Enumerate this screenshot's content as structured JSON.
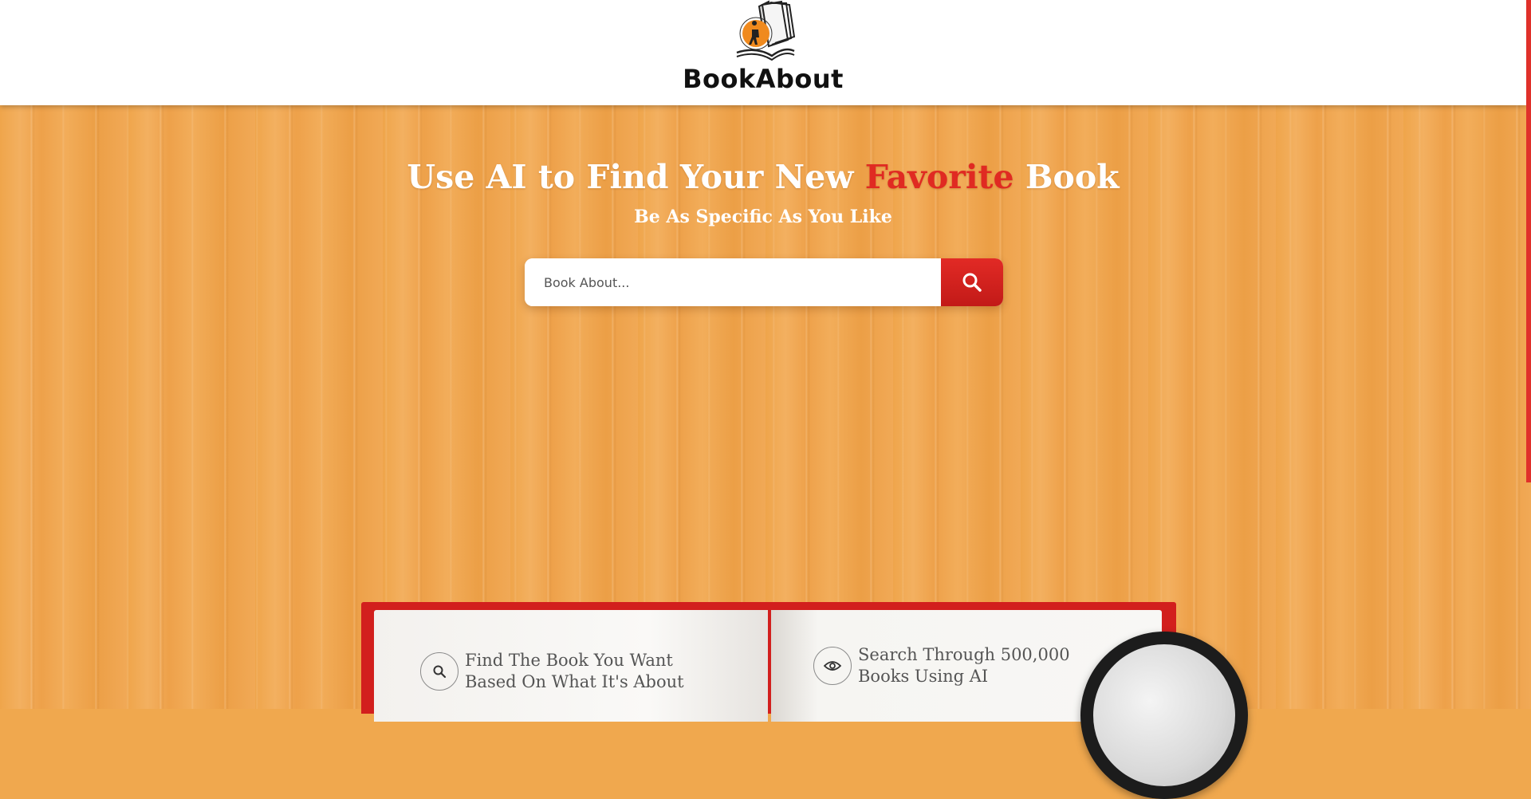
{
  "header": {
    "brand": "BookAbout"
  },
  "hero": {
    "headline_before": "Use AI to Find Your New",
    "headline_accent": "Favorite",
    "headline_after": "Book",
    "subheadline": "Be As Specific As You Like",
    "search": {
      "placeholder": "Book About...",
      "value": ""
    }
  },
  "features": [
    {
      "icon": "search-icon",
      "line1": "Find The Book You Want",
      "line2": "Based On What It's About"
    },
    {
      "icon": "eye-icon",
      "line1": "Search Through 500,000",
      "line2": "Books Using AI"
    }
  ],
  "colors": {
    "accent": "#e02a22",
    "background": "#f0a84e",
    "header": "#ffffff"
  }
}
